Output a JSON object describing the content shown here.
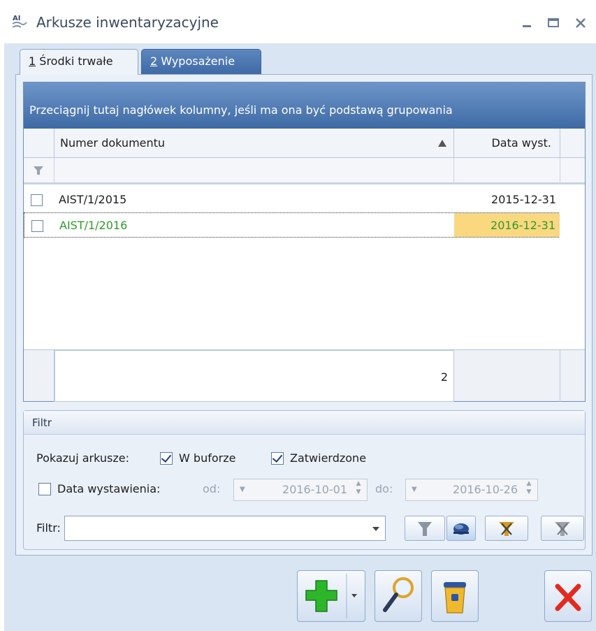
{
  "window": {
    "title": "Arkusze inwentaryzacyjne",
    "app_icon_text": "AI"
  },
  "tabs": [
    {
      "key": "1",
      "label": "Środki trwałe",
      "active": true
    },
    {
      "key": "2",
      "label": "Wyposażenie",
      "active": false
    }
  ],
  "grid": {
    "group_hint": "Przeciągnij tutaj nagłówek kolumny, jeśli ma ona być podstawą grupowania",
    "columns": [
      "Numer dokumentu",
      "Data wyst."
    ],
    "rows": [
      {
        "doc": "AIST/1/2015",
        "date": "2015-12-31",
        "selected": false
      },
      {
        "doc": "AIST/1/2016",
        "date": "2016-12-31",
        "selected": true
      }
    ],
    "footer_count": "2"
  },
  "filter": {
    "group_title": "Filtr",
    "show_label": "Pokazuj arkusze:",
    "in_buffer_label": "W buforze",
    "in_buffer_checked": true,
    "approved_label": "Zatwierdzone",
    "approved_checked": true,
    "issue_date_label": "Data wystawienia:",
    "issue_date_checked": false,
    "from_label": "od:",
    "from_value": "2016-10-01",
    "to_label": "do:",
    "to_value": "2016-10-26",
    "filter_label": "Filtr:",
    "filter_value": ""
  },
  "colors": {
    "accent": "#3e6aa5",
    "selected_row_text": "#2e9a2a",
    "selected_date_bg": "#f9d880",
    "close_red": "#e32a1f"
  }
}
